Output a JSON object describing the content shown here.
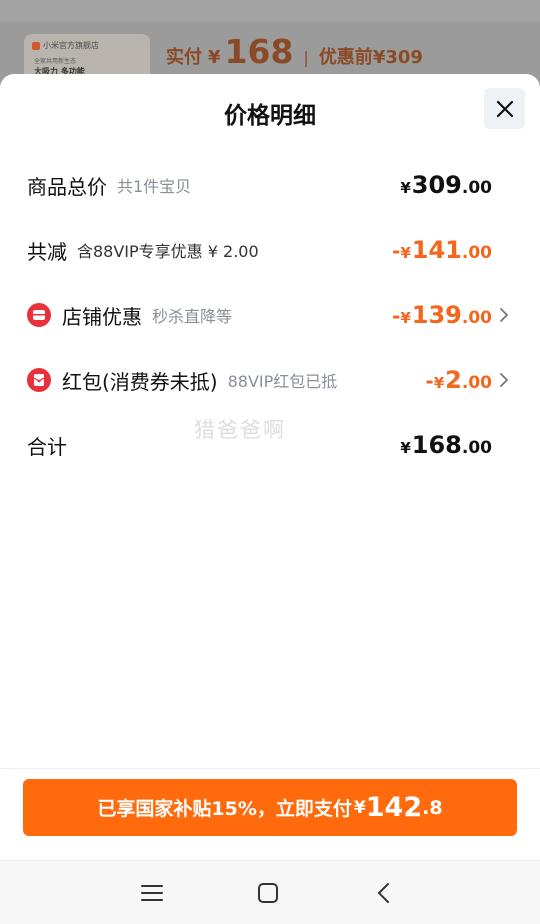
{
  "background": {
    "store_name": "小米官方旗舰店",
    "thumb_subtitle": "全家共用新生态",
    "thumb_tagline": "大吸力 多功能",
    "actual_pay_label": "实付",
    "currency": "¥",
    "actual_pay_amount": "168",
    "before_discount_label": "优惠前",
    "before_discount_amount": "¥309"
  },
  "sheet": {
    "title": "价格明细",
    "close_icon": "close-icon",
    "rows": [
      {
        "label": "商品总价",
        "sub": "共1件宝贝",
        "minus": "",
        "currency": "¥",
        "int": "309",
        "dec": ".00",
        "color": "#111111"
      },
      {
        "label": "共减",
        "sub": "含88VIP专享优惠 ¥ 2.00",
        "minus": "-",
        "currency": "¥",
        "int": "141",
        "dec": ".00",
        "color": "#f3661d"
      },
      {
        "label": "店铺优惠",
        "sub": "秒杀直降等",
        "icon": "shop-coupon-icon",
        "minus": "-",
        "currency": "¥",
        "int": "139",
        "dec": ".00",
        "color": "#f3661d"
      },
      {
        "label": "红包(消费券未抵)",
        "sub": "88VIP红包已抵",
        "icon": "red-envelope-icon",
        "minus": "-",
        "currency": "¥",
        "int": "2",
        "dec": ".00",
        "color": "#f3661d"
      },
      {
        "label": "合计",
        "sub": "",
        "minus": "",
        "currency": "¥",
        "int": "168",
        "dec": ".00",
        "color": "#111111"
      }
    ],
    "watermark": "猎爸爸啊"
  },
  "pay_button": {
    "text": "已享国家补贴15%，立即支付",
    "currency": "¥",
    "amount": "142",
    "decimal": ".8",
    "color": "#ff6a0c"
  },
  "navbar": {
    "items": [
      "menu-icon",
      "home-icon",
      "back-icon"
    ]
  }
}
